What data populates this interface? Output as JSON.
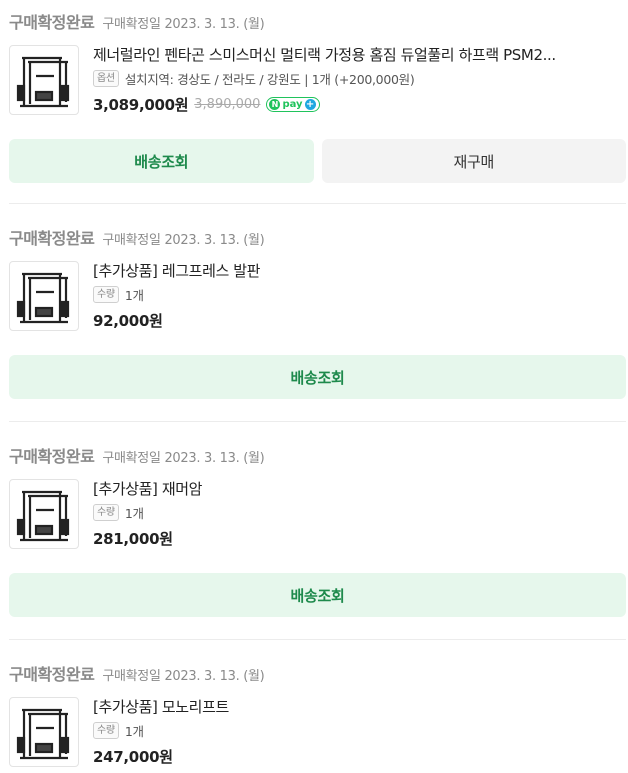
{
  "orders": [
    {
      "status": "구매확정완료",
      "date_label": "구매확정일 2023. 3. 13. (월)",
      "product_title": "제너럴라인 펜타곤 스미스머신 멀티랙 가정용 홈짐 듀얼풀리 하프랙 PSM2...",
      "tag": "옵션",
      "meta": "설치지역: 경상도 / 전라도 / 강원도 | 1개 (+200,000원)",
      "price": "3,089,000원",
      "original_price": "3,890,000",
      "npay_label": "pay",
      "buttons": [
        "배송조회",
        "재구매"
      ]
    },
    {
      "status": "구매확정완료",
      "date_label": "구매확정일 2023. 3. 13. (월)",
      "product_title": "[추가상품] 레그프레스 발판",
      "tag": "수량",
      "meta": "1개",
      "price": "92,000원",
      "buttons": [
        "배송조회"
      ]
    },
    {
      "status": "구매확정완료",
      "date_label": "구매확정일 2023. 3. 13. (월)",
      "product_title": "[추가상품] 재머암",
      "tag": "수량",
      "meta": "1개",
      "price": "281,000원",
      "buttons": [
        "배송조회"
      ]
    },
    {
      "status": "구매확정완료",
      "date_label": "구매확정일 2023. 3. 13. (월)",
      "product_title": "[추가상품] 모노리프트",
      "tag": "수량",
      "meta": "1개",
      "price": "247,000원",
      "buttons": []
    }
  ],
  "colors": {
    "status_gray": "#8a8a8a",
    "button_green_bg": "#e6f7ec",
    "button_green_text": "#1e8a4c",
    "npay_green": "#20c35c"
  },
  "icons": {
    "thumbnail": "smith-machine-rack-thumbnail",
    "npay": "naver-pay-plus-icon"
  }
}
